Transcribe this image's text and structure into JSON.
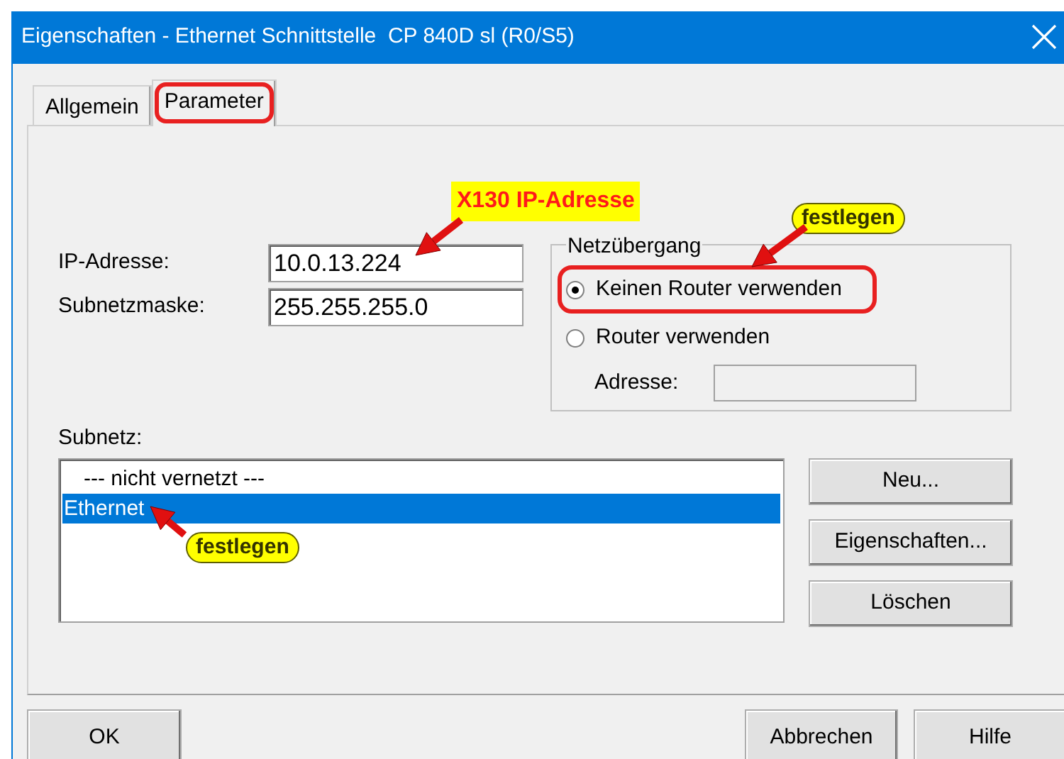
{
  "window": {
    "title": "Eigenschaften - Ethernet Schnittstelle  CP 840D sl (R0/S5)"
  },
  "tabs": [
    {
      "label": "Allgemein",
      "selected": false,
      "highlighted": false
    },
    {
      "label": "Parameter",
      "selected": true,
      "highlighted": true
    }
  ],
  "fields": [
    {
      "label": "IP-Adresse:",
      "value": "10.0.13.224"
    },
    {
      "label": "Subnetzmaske:",
      "value": "255.255.255.0"
    }
  ],
  "gateway": {
    "title": "Netzübergang",
    "options": [
      {
        "label": "Keinen Router verwenden",
        "selected": true,
        "highlighted": true
      },
      {
        "label": "Router verwenden",
        "selected": false,
        "highlighted": false
      }
    ],
    "address": {
      "label": "Adresse:",
      "disabled": true
    }
  },
  "subnet": {
    "label": "Subnetz:",
    "items": [
      {
        "label": "--- nicht vernetzt ---",
        "selected": false
      },
      {
        "label": "Ethernet",
        "selected": true
      }
    ],
    "buttons": [
      "Neu...",
      "Eigenschaften...",
      "Löschen"
    ]
  },
  "annotations": [
    {
      "kind": "box",
      "text": "X130 IP-Adresse"
    },
    {
      "kind": "pill",
      "text": "festlegen"
    },
    {
      "kind": "pill",
      "text": "festlegen"
    }
  ],
  "buttons": [
    "OK",
    "Abbrechen",
    "Hilfe"
  ]
}
